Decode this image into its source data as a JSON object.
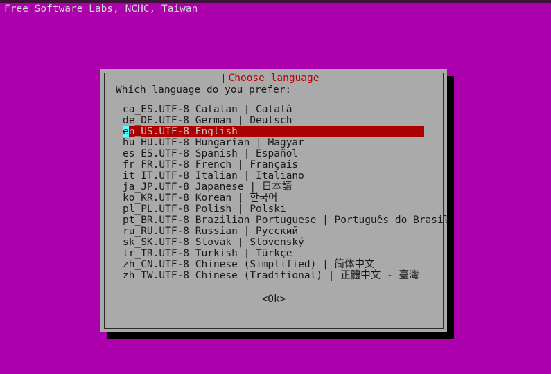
{
  "screen": {
    "background_color": "#ab00ab",
    "top_strip_color": "#3d1238",
    "banner_text": "Free Software Labs, NCHC, Taiwan"
  },
  "dialog": {
    "title": "Choose language",
    "title_color": "#bb0000",
    "background_color": "#aaaaaa",
    "border_color": "#2b2b2b",
    "shadow_color": "#000000",
    "prompt": "Which language do you prefer:",
    "highlight_color": "#aa0000",
    "highlight_text_color": "#c8c8c8",
    "cursor_color": "#55ffff",
    "ok_label": "<Ok>",
    "selected_index": 2,
    "languages": [
      {
        "locale": "ca_ES.UTF-8",
        "label": "Catalan | Català"
      },
      {
        "locale": "de_DE.UTF-8",
        "label": "German | Deutsch"
      },
      {
        "locale": "en_US.UTF-8",
        "label": "English"
      },
      {
        "locale": "hu_HU.UTF-8",
        "label": "Hungarian | Magyar"
      },
      {
        "locale": "es_ES.UTF-8",
        "label": "Spanish | Español"
      },
      {
        "locale": "fr_FR.UTF-8",
        "label": "French | Français"
      },
      {
        "locale": "it_IT.UTF-8",
        "label": "Italian | Italiano"
      },
      {
        "locale": "ja_JP.UTF-8",
        "label": "Japanese | 日本語"
      },
      {
        "locale": "ko_KR.UTF-8",
        "label": "Korean | 한국어"
      },
      {
        "locale": "pl_PL.UTF-8",
        "label": "Polish | Polski"
      },
      {
        "locale": "pt_BR.UTF-8",
        "label": "Brazilian Portuguese | Português do Brasil"
      },
      {
        "locale": "ru_RU.UTF-8",
        "label": "Russian | Русский"
      },
      {
        "locale": "sk_SK.UTF-8",
        "label": "Slovak | Slovenský"
      },
      {
        "locale": "tr_TR.UTF-8",
        "label": "Turkish | Türkçe"
      },
      {
        "locale": "zh_CN.UTF-8",
        "label": "Chinese (Simplified) | 简体中文"
      },
      {
        "locale": "zh_TW.UTF-8",
        "label": "Chinese (Traditional) | 正體中文 - 臺灣"
      }
    ]
  }
}
